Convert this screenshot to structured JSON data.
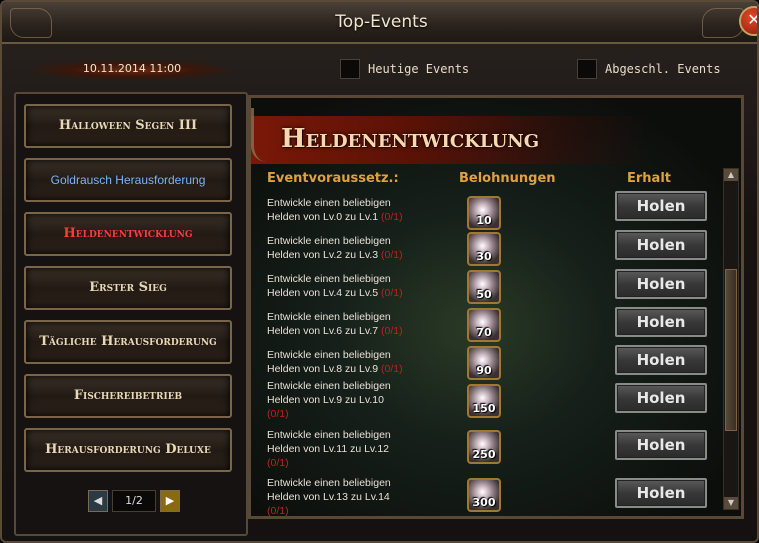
{
  "window": {
    "title": "Top-Events",
    "close_label": "✕"
  },
  "header": {
    "date": "10.11.2014 11:00",
    "filters": [
      {
        "label": "Heutige Events",
        "checked": false
      },
      {
        "label": "Abgeschl. Events",
        "checked": false
      }
    ]
  },
  "sidebar": {
    "items": [
      {
        "label": "Halloween Segen III",
        "state": "normal"
      },
      {
        "label": "Goldrausch Herausforderung",
        "state": "highlight-blue"
      },
      {
        "label": "Heldenentwicklung",
        "state": "active"
      },
      {
        "label": "Erster Sieg",
        "state": "normal"
      },
      {
        "label": "Tägliche Herausforderung",
        "state": "normal"
      },
      {
        "label": "Fischereibetrieb",
        "state": "normal"
      },
      {
        "label": "Herausforderung Deluxe",
        "state": "normal"
      }
    ],
    "pager": {
      "prev": "◀",
      "next": "▶",
      "page": "1/2"
    }
  },
  "main": {
    "banner": "Heldenentwicklung",
    "columns": {
      "requirement": "Eventvoraussetz.:",
      "reward": "Belohnungen",
      "action": "Erhalt"
    },
    "rows": [
      {
        "line1": "Entwickle einen beliebigen",
        "line2": "Helden von Lv.0 zu Lv.1",
        "progress": "(0/1)",
        "reward": "10",
        "button": "Holen"
      },
      {
        "line1": "Entwickle einen beliebigen",
        "line2": "Helden von Lv.2 zu Lv.3",
        "progress": "(0/1)",
        "reward": "30",
        "button": "Holen"
      },
      {
        "line1": "Entwickle einen beliebigen",
        "line2": "Helden von Lv.4 zu Lv.5",
        "progress": "(0/1)",
        "reward": "50",
        "button": "Holen"
      },
      {
        "line1": "Entwickle einen beliebigen",
        "line2": "Helden von Lv.6 zu Lv.7",
        "progress": "(0/1)",
        "reward": "70",
        "button": "Holen"
      },
      {
        "line1": "Entwickle einen beliebigen",
        "line2": "Helden von Lv.8 zu Lv.9",
        "progress": "(0/1)",
        "reward": "90",
        "button": "Holen"
      },
      {
        "line1": "Entwickle einen beliebigen",
        "line2": "Helden von Lv.9 zu Lv.10",
        "progress": "(0/1)",
        "reward": "150",
        "button": "Holen"
      },
      {
        "line1": "Entwickle einen beliebigen",
        "line2": "Helden von Lv.11 zu Lv.12",
        "progress": "(0/1)",
        "reward": "250",
        "button": "Holen"
      },
      {
        "line1": "Entwickle einen beliebigen",
        "line2": "Helden von Lv.13 zu Lv.14",
        "progress": "(0/1)",
        "reward": "300",
        "button": "Holen"
      }
    ]
  },
  "scrollbar": {
    "up": "▲",
    "down": "▼"
  }
}
